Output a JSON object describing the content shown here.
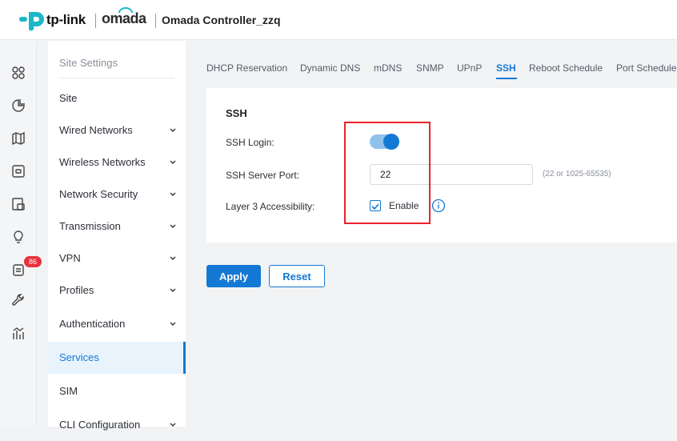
{
  "header": {
    "brand": "tp-link",
    "product": "omada",
    "controller_name": "Omada Controller_zzq"
  },
  "iconbar": {
    "icons": [
      "dashboard-icon",
      "statistics-icon",
      "map-icon",
      "devices-icon",
      "clients-icon",
      "insights-icon",
      "logs-icon",
      "tools-icon",
      "reports-icon"
    ],
    "log_badge": "86"
  },
  "sidebar": {
    "heading": "Site Settings",
    "items": [
      {
        "label": "Site",
        "has_chevron": false
      },
      {
        "label": "Wired Networks",
        "has_chevron": true
      },
      {
        "label": "Wireless Networks",
        "has_chevron": true
      },
      {
        "label": "Network Security",
        "has_chevron": true
      },
      {
        "label": "Transmission",
        "has_chevron": true
      },
      {
        "label": "VPN",
        "has_chevron": true
      },
      {
        "label": "Profiles",
        "has_chevron": true
      },
      {
        "label": "Authentication",
        "has_chevron": true
      },
      {
        "label": "Services",
        "has_chevron": false,
        "active": true
      },
      {
        "label": "SIM",
        "has_chevron": false
      },
      {
        "label": "CLI Configuration",
        "has_chevron": true
      }
    ]
  },
  "tabs": [
    {
      "label": "DHCP Reservation"
    },
    {
      "label": "Dynamic DNS"
    },
    {
      "label": "mDNS"
    },
    {
      "label": "SNMP"
    },
    {
      "label": "UPnP"
    },
    {
      "label": "SSH",
      "active": true
    },
    {
      "label": "Reboot Schedule"
    },
    {
      "label": "Port Schedule"
    }
  ],
  "ssh": {
    "title": "SSH",
    "login_label": "SSH Login:",
    "login_enabled": true,
    "port_label": "SSH Server Port:",
    "port_value": "22",
    "port_hint": "(22 or 1025-65535)",
    "l3_label": "Layer 3 Accessibility:",
    "l3_enable_label": "Enable",
    "l3_enabled": true
  },
  "actions": {
    "apply_label": "Apply",
    "reset_label": "Reset"
  },
  "colors": {
    "accent": "#1479d4",
    "highlight_box": "#e8232b",
    "badge": "#e8323c"
  }
}
